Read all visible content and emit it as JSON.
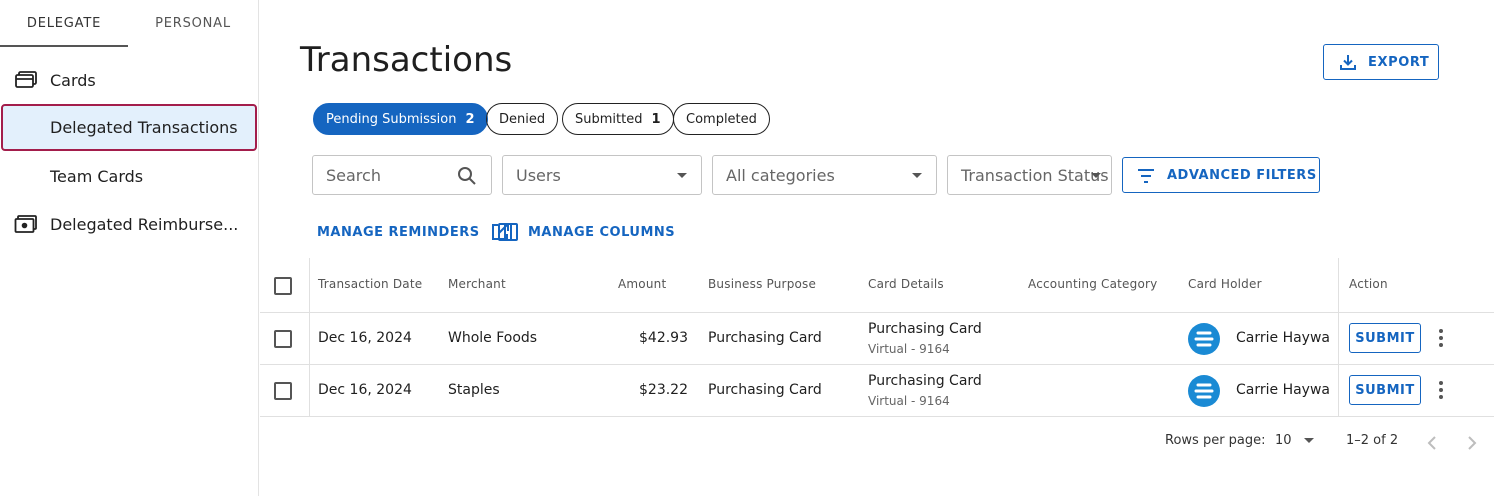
{
  "sidebar": {
    "tabs": [
      {
        "label": "DELEGATE"
      },
      {
        "label": "PERSONAL"
      }
    ],
    "items": [
      {
        "label": "Cards",
        "icon": "cards-icon"
      },
      {
        "label": "Delegated Transactions"
      },
      {
        "label": "Team Cards"
      },
      {
        "label": "Delegated Reimburse..."
      }
    ]
  },
  "page": {
    "title": "Transactions",
    "export_label": "EXPORT"
  },
  "chips": [
    {
      "label": "Pending Submission",
      "count": "2",
      "selected": true
    },
    {
      "label": "Denied",
      "count": ""
    },
    {
      "label": "Submitted",
      "count": "1"
    },
    {
      "label": "Completed",
      "count": ""
    }
  ],
  "filters": {
    "search_placeholder": "Search",
    "users_placeholder": "Users",
    "categories_placeholder": "All categories",
    "status_placeholder": "Transaction Status",
    "advanced_label": "ADVANCED FILTERS"
  },
  "links": {
    "reminders_label": "MANAGE REMINDERS",
    "columns_label": "MANAGE COLUMNS"
  },
  "table": {
    "headers": [
      "Transaction Date",
      "Merchant",
      "Amount",
      "Business Purpose",
      "Card Details",
      "Accounting Category",
      "Card Holder",
      "Action"
    ],
    "rows": [
      {
        "date": "Dec 16, 2024",
        "merchant": "Whole Foods",
        "amount": "$42.93",
        "purpose": "Purchasing Card",
        "card_name": "Purchasing Card",
        "card_sub": "Virtual - 9164",
        "category": "",
        "holder": "Carrie Hayward",
        "action": "SUBMIT"
      },
      {
        "date": "Dec 16, 2024",
        "merchant": "Staples",
        "amount": "$23.22",
        "purpose": "Purchasing Card",
        "card_name": "Purchasing Card",
        "card_sub": "Virtual - 9164",
        "category": "",
        "holder": "Carrie Hayward",
        "action": "SUBMIT"
      }
    ]
  },
  "pagination": {
    "rows_per_page_label": "Rows per page:",
    "rows_per_page_value": "10",
    "range": "1–2 of 2"
  },
  "colors": {
    "primary": "#1565c0",
    "active_bg": "#e3f0fc",
    "active_outline": "#a31d4b",
    "avatar": "#1a8ad4"
  }
}
